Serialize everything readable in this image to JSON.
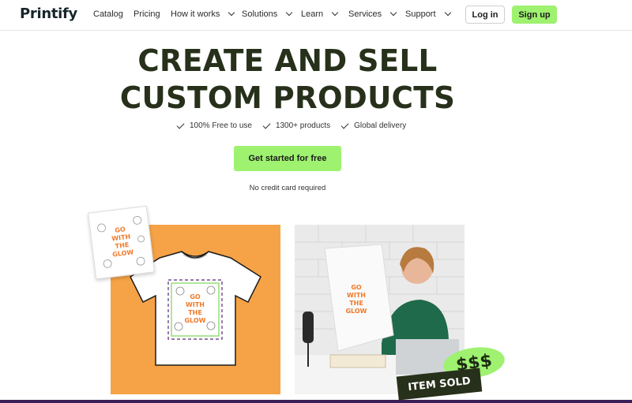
{
  "brand": {
    "logo": "Printify"
  },
  "nav": {
    "items": [
      {
        "label": "Catalog",
        "dropdown": false
      },
      {
        "label": "Pricing",
        "dropdown": false
      },
      {
        "label": "How it works",
        "dropdown": true
      },
      {
        "label": "Solutions",
        "dropdown": true
      },
      {
        "label": "Learn",
        "dropdown": true
      },
      {
        "label": "Services",
        "dropdown": true
      },
      {
        "label": "Support",
        "dropdown": true
      }
    ],
    "login_label": "Log in",
    "signup_label": "Sign up"
  },
  "hero": {
    "headline_line1": "CREATE AND SELL",
    "headline_line2": "CUSTOM PRODUCTS",
    "features": [
      "100% Free to use",
      "1300+ products",
      "Global delivery"
    ],
    "cta_label": "Get started for free",
    "cta_note": "No credit card required"
  },
  "artwork": {
    "design_text_line1": "GO",
    "design_text_line2": "WITH",
    "design_text_line3": "THE",
    "design_text_line4": "GLOW",
    "badge_money": "$$$",
    "badge_sold": "ITEM SOLD"
  },
  "colors": {
    "accent_green": "#9ef26f",
    "headline_dark": "#27301a",
    "orange_tile": "#f6a246",
    "design_orange": "#f07a2b"
  },
  "icons": {
    "feature_check": "check-icon",
    "nav_dropdown": "chevron-down-icon"
  }
}
